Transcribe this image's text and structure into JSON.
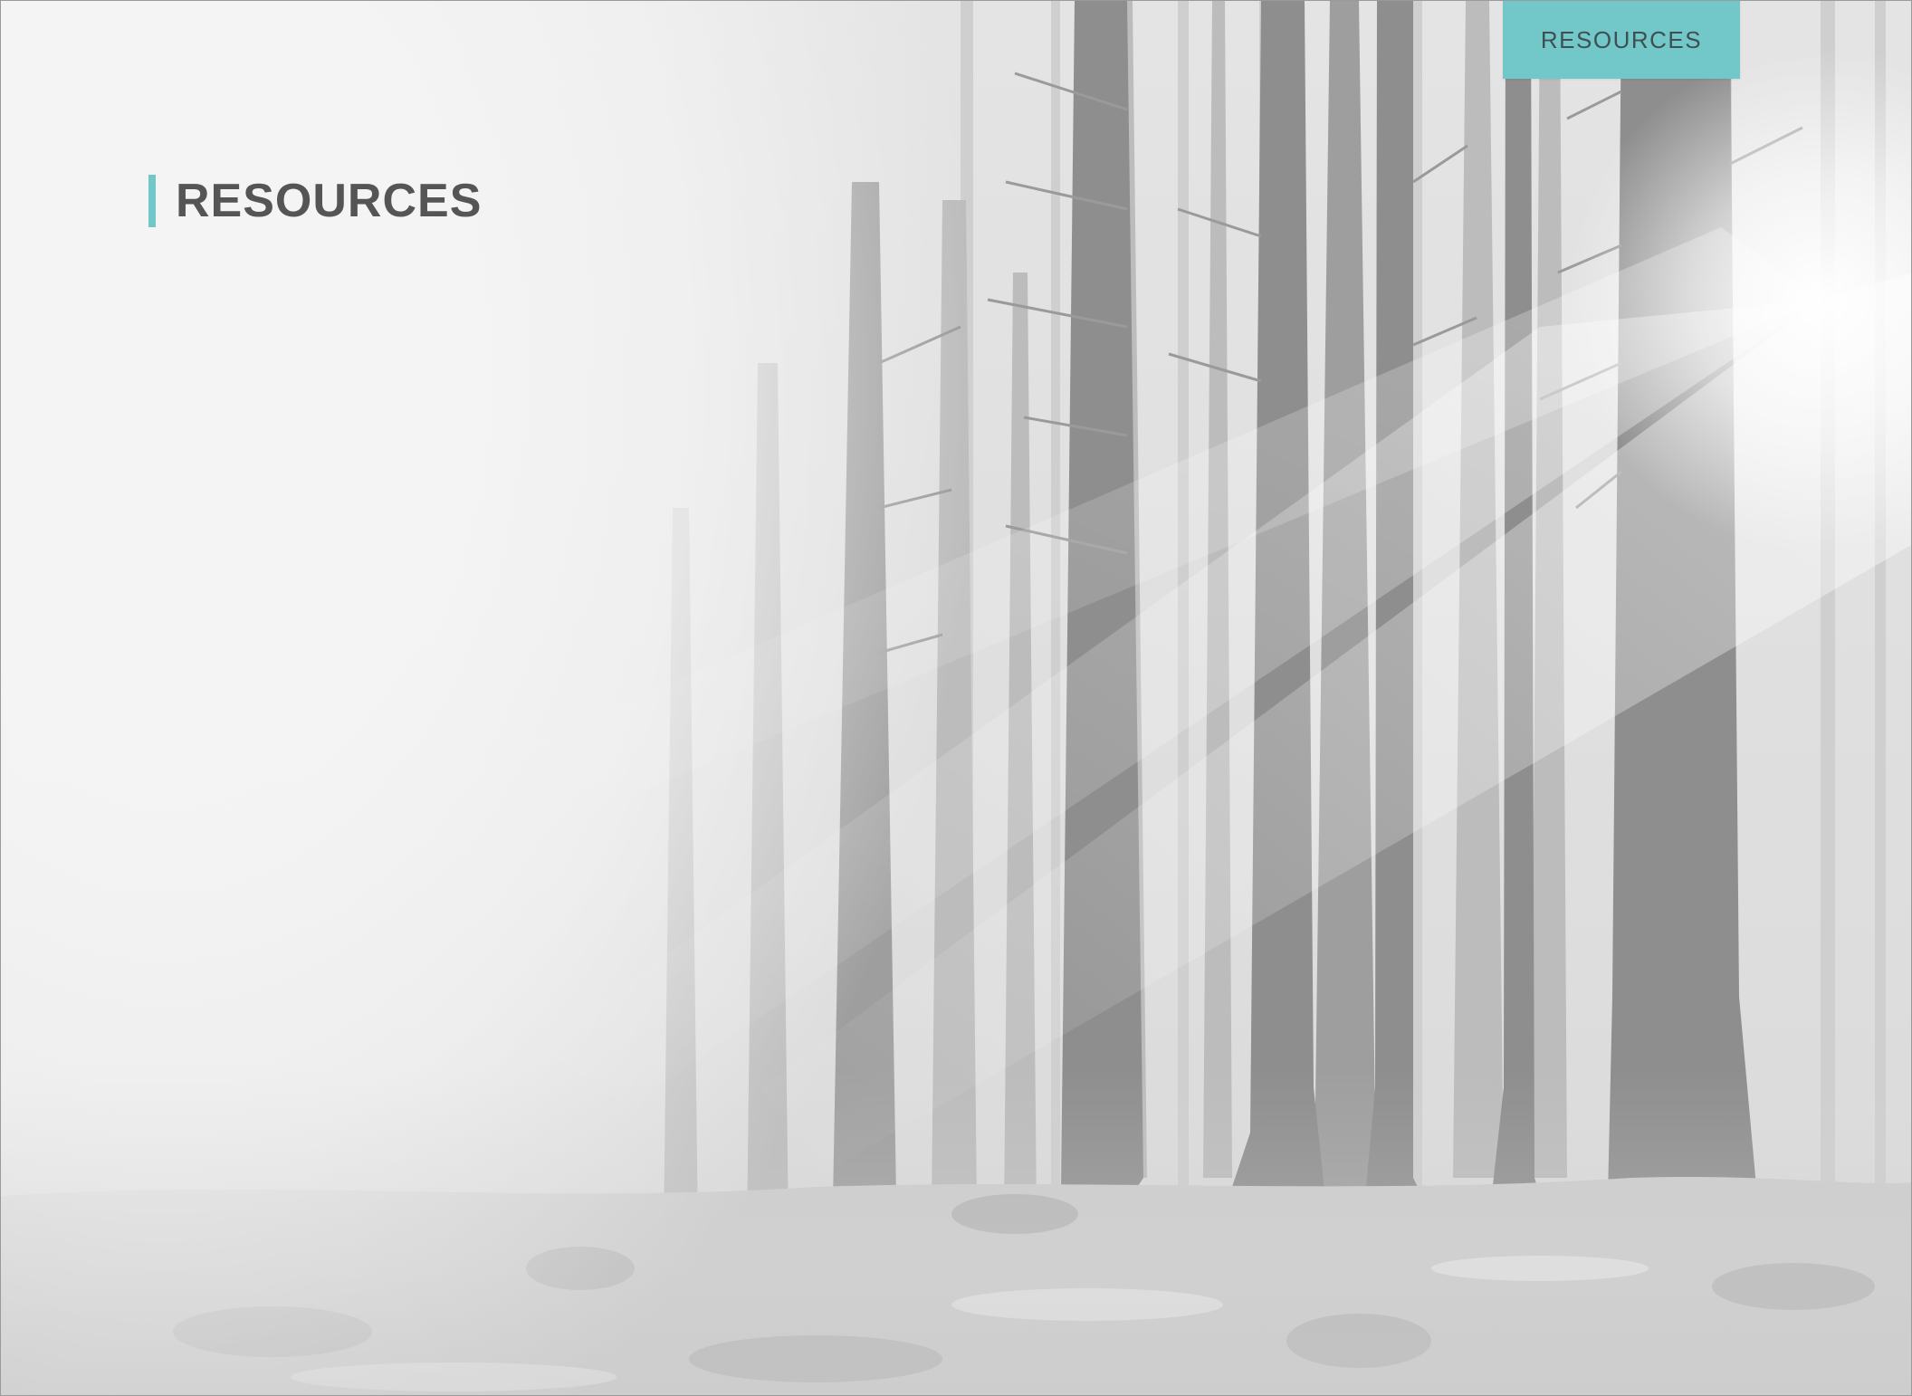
{
  "header": {
    "tab_label": "RESOURCES"
  },
  "page": {
    "title": "RESOURCES",
    "background_image": "misty-forest-with-sunbeams",
    "accent_color": "#72c8c8",
    "title_color": "#555555"
  }
}
